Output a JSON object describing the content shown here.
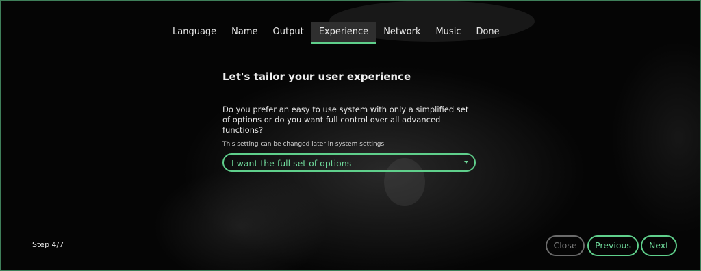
{
  "tabs": [
    {
      "label": "Language",
      "active": false
    },
    {
      "label": "Name",
      "active": false
    },
    {
      "label": "Output",
      "active": false
    },
    {
      "label": "Experience",
      "active": true
    },
    {
      "label": "Network",
      "active": false
    },
    {
      "label": "Music",
      "active": false
    },
    {
      "label": "Done",
      "active": false
    }
  ],
  "main": {
    "heading": "Let's tailor your user experience",
    "question": "Do you prefer an easy to use system with only a simplified set of options or do you want full control over all advanced functions?",
    "hint": "This setting can be changed later in system settings",
    "select_value": "I want the full set of options"
  },
  "footer": {
    "step": "Step 4/7",
    "close_label": "Close",
    "previous_label": "Previous",
    "next_label": "Next"
  },
  "colors": {
    "accent": "#5fcf8b",
    "disabled": "#6b6b6b"
  }
}
